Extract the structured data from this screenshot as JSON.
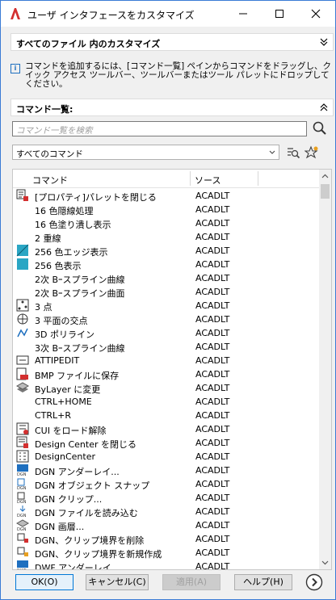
{
  "window": {
    "title": "ユーザ インタフェースをカスタマイズ",
    "controls": {
      "minimize": "—",
      "maximize": "☐",
      "close": "✕"
    }
  },
  "customize_section": {
    "label": "すべてのファイル 内のカスタマイズ"
  },
  "info": {
    "text": "コマンドを追加するには、[コマンド一覧] ペインからコマンドをドラッグし、クイック アクセス ツールバー、ツールバーまたはツール パレットにドロップしてください。"
  },
  "commands_section": {
    "label": "コマンド一覧:"
  },
  "search": {
    "placeholder": "コマンド一覧を検索"
  },
  "filter": {
    "selected": "すべてのコマンド"
  },
  "table": {
    "columns": [
      "コマンド",
      "ソース"
    ],
    "rows": [
      {
        "name": "[プロパティ]パレットを閉じる",
        "source": "ACADLT",
        "icon": "properties-close-icon"
      },
      {
        "name": "16 色隠線処理",
        "source": "ACADLT",
        "icon": ""
      },
      {
        "name": "16 色塗り潰し表示",
        "source": "ACADLT",
        "icon": ""
      },
      {
        "name": "2 重線",
        "source": "ACADLT",
        "icon": ""
      },
      {
        "name": "256 色エッジ表示",
        "source": "ACADLT",
        "icon": "color-256-edge-icon"
      },
      {
        "name": "256 色表示",
        "source": "ACADLT",
        "icon": "color-256-icon"
      },
      {
        "name": "2次 Bｰスプライン曲線",
        "source": "ACADLT",
        "icon": ""
      },
      {
        "name": "2次 Bｰスプライン曲面",
        "source": "ACADLT",
        "icon": ""
      },
      {
        "name": "3 点",
        "source": "ACADLT",
        "icon": "three-point-icon"
      },
      {
        "name": "3 平面の交点",
        "source": "ACADLT",
        "icon": "three-plane-intersection-icon"
      },
      {
        "name": "3D ポリライン",
        "source": "ACADLT",
        "icon": "polyline-3d-icon"
      },
      {
        "name": "3次 Bｰスプライン曲線",
        "source": "ACADLT",
        "icon": ""
      },
      {
        "name": "ATTIPEDIT",
        "source": "ACADLT",
        "icon": "attipedit-icon"
      },
      {
        "name": "BMP ファイルに保存",
        "source": "ACADLT",
        "icon": "bmp-save-icon"
      },
      {
        "name": "ByLayer に変更",
        "source": "ACADLT",
        "icon": "bylayer-icon"
      },
      {
        "name": "CTRL+HOME",
        "source": "ACADLT",
        "icon": ""
      },
      {
        "name": "CTRL+R",
        "source": "ACADLT",
        "icon": ""
      },
      {
        "name": "CUI をロード解除",
        "source": "ACADLT",
        "icon": "cui-unload-icon"
      },
      {
        "name": "Design Center を閉じる",
        "source": "ACADLT",
        "icon": "design-center-close-icon"
      },
      {
        "name": "DesignCenter",
        "source": "ACADLT",
        "icon": "design-center-icon"
      },
      {
        "name": "DGN アンダーレイ...",
        "source": "ACADLT",
        "icon": "dgn-underlay-icon"
      },
      {
        "name": "DGN オブジェクト スナップ",
        "source": "ACADLT",
        "icon": "dgn-snap-icon"
      },
      {
        "name": "DGN クリップ...",
        "source": "ACADLT",
        "icon": "dgn-clip-icon"
      },
      {
        "name": "DGN ファイルを読み込む",
        "source": "ACADLT",
        "icon": "dgn-import-icon"
      },
      {
        "name": "DGN 画層...",
        "source": "ACADLT",
        "icon": "dgn-layers-icon"
      },
      {
        "name": "DGN、クリップ境界を削除",
        "source": "ACADLT",
        "icon": "dgn-clip-delete-icon"
      },
      {
        "name": "DGN、クリップ境界を新規作成",
        "source": "ACADLT",
        "icon": "dgn-clip-new-icon"
      },
      {
        "name": "DWF アンダーレイ...",
        "source": "ACADLT",
        "icon": "dwf-underlay-icon"
      }
    ]
  },
  "buttons": {
    "ok": "OK(O)",
    "cancel": "キャンセル(C)",
    "apply": "適用(A)",
    "help": "ヘルプ(H)"
  },
  "colors": {
    "accent": "#3a7bd5",
    "app_red": "#d32f2f",
    "icon_blue": "#1e6fbf",
    "icon_teal": "#2aa6c4"
  }
}
